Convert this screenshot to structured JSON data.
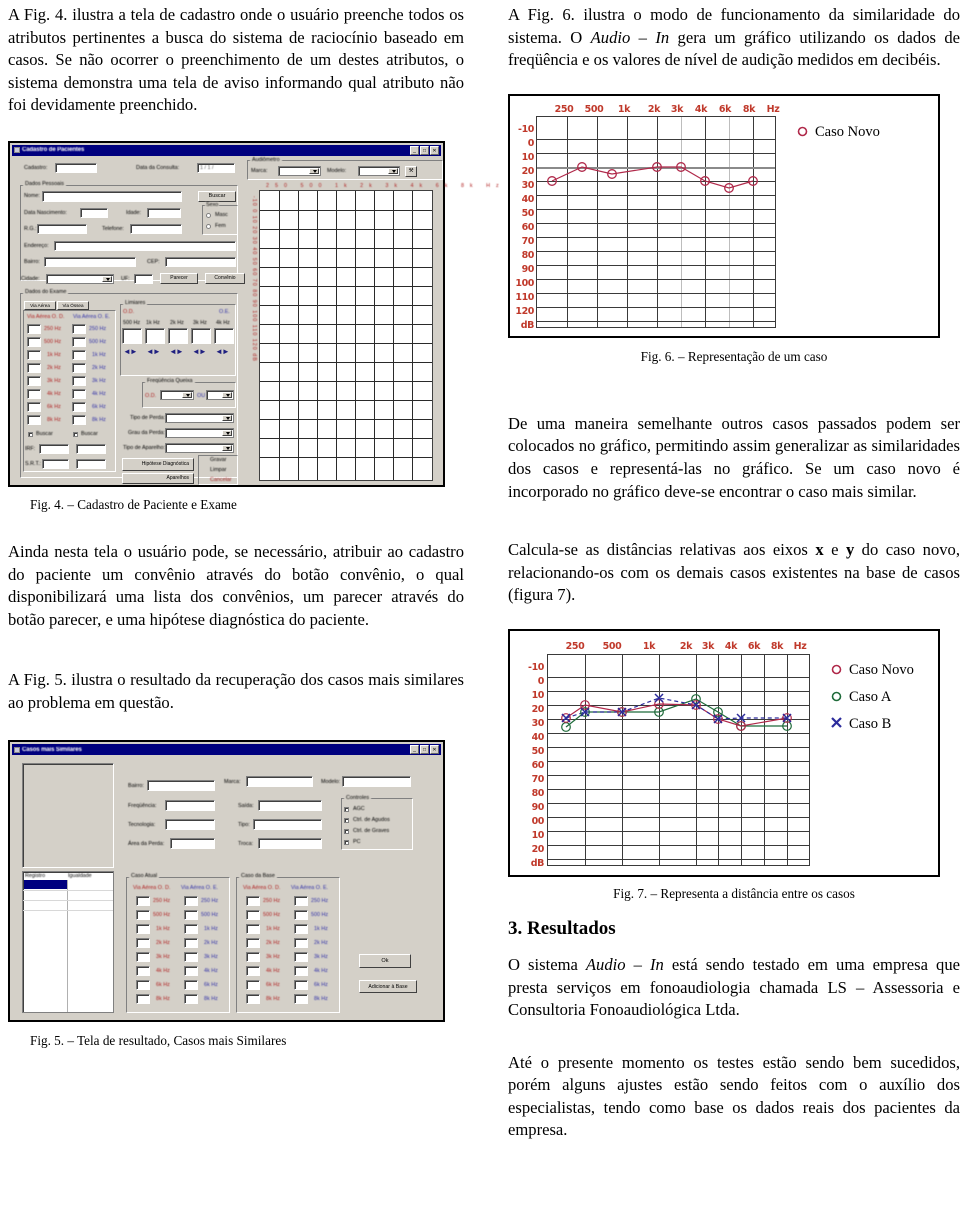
{
  "left_column": {
    "para1_prefix": "A Fig. 4.",
    "para1": "A Fig. 4. ilustra a tela de cadastro onde o usuário preenche todos os atributos pertinentes a busca do sistema de raciocínio baseado em casos. Se não ocorrer o preenchimento de um destes atributos, o sistema demonstra uma tela de aviso informando qual atributo não foi devidamente preenchido.",
    "fig4_caption": "Fig. 4. – Cadastro de Paciente e Exame",
    "para2": "Ainda nesta tela o usuário pode, se necessário, atribuir ao cadastro do paciente um convênio através do botão convênio, o qual disponibilizará uma lista dos convênios, um parecer através do botão parecer, e uma hipótese diagnóstica do paciente.",
    "para3": "A Fig. 5. ilustra o resultado da recuperação dos casos mais similares ao problema em questão.",
    "fig5_caption": "Fig. 5. – Tela de resultado, Casos mais Similares"
  },
  "right_column": {
    "para1_a": "A Fig. 6. ilustra o modo de funcionamento da similaridade do sistema. O ",
    "para1_italic": "Audio – In",
    "para1_b": " gera um gráfico utilizando os dados de freqüência e os valores de nível de audição medidos em decibéis.",
    "fig6_caption": "Fig. 6. – Representação de um caso",
    "para2": "De uma maneira semelhante outros casos passados podem ser colocados no gráfico, permitindo assim generalizar as similaridades dos casos e representá-las no gráfico. Se um caso novo é incorporado no gráfico deve-se encontrar o caso mais similar.",
    "para3_a": "Calcula-se as distâncias relativas aos eixos ",
    "para3_x": "x",
    "para3_mid": " e ",
    "para3_y": "y",
    "para3_b": " do caso novo, relacionando-os com os demais casos existentes na base de casos (figura 7).",
    "fig7_caption": "Fig. 7. – Representa a distância entre os casos",
    "section_heading": "3. Resultados",
    "para4_a": "O sistema ",
    "para4_italic": "Audio – In",
    "para4_b": " está sendo testado em uma empresa que presta serviços em fonoaudiologia chamada LS – Assessoria e Consultoria Fonoaudiológica Ltda.",
    "para5": "Até o presente momento os testes estão sendo bem sucedidos, porém alguns ajustes estão sendo feitos com o auxílio dos especialistas, tendo como base os dados reais dos pacientes da empresa."
  },
  "fig4_window": {
    "title": "Cadastro de Pacientes",
    "title_icon": "window-icon",
    "buttons": {
      "minimize": "_",
      "maximize": "□",
      "close": "✕"
    },
    "labels": {
      "cadastro": "Cadastro:",
      "data_consulta": "Data da Consulta:",
      "audiometro_group": "Audiômetro",
      "marca": "Marca:",
      "modelo": "Modelo:",
      "dados_pessoais": "Dados Pessoais",
      "nome": "Nome:",
      "buscar": "Buscar",
      "data_nascimento": "Data Nascimento:",
      "idade": "Idade:",
      "rg": "R.G.:",
      "telefone": "Telefone:",
      "endereco": "Endereço:",
      "bairro": "Bairro:",
      "cep": "CEP:",
      "cidade": "Cidade:",
      "uf": "UF:",
      "parecer": "Parecer",
      "convenio": "Convênio",
      "sexo_group": "Sexo",
      "sexo_masc": "Masc",
      "sexo_fem": "Fem",
      "dados_exame": "Dados do Exame",
      "tab_via_aerea": "Via Aérea",
      "tab_via_ossea": "Via Óssea",
      "via_aerea_od": "Via Aérea O. D.",
      "via_aerea_oe": "Via Aérea O. E.",
      "limiares": "Limiares",
      "od": "O.D.",
      "oe": "O.E.",
      "buscar_chk": "Buscar",
      "irf": "IRF:",
      "srt": "S.R.T.:",
      "freq_queixa": "Freqüência Queixa",
      "ou": "OU",
      "tipo_perda": "Tipo de Perda:",
      "grau_perda": "Grau da Perda:",
      "tipo_aparelho": "Tipo de Aparelho:",
      "hipotese": "Hipótese Diagnóstica",
      "aparelhos": "Aparelhos",
      "gravar": "Gravar",
      "limpar": "Limpar",
      "cancelar": "Cancelar"
    },
    "date_value": "1 / 1 /",
    "freq_cols": [
      "500 Hz",
      "1k Hz",
      "2k Hz",
      "3k Hz",
      "4k Hz"
    ],
    "freq_rows": [
      "250 Hz",
      "500 Hz",
      "1k Hz",
      "2k Hz",
      "3k Hz",
      "4k Hz",
      "6k Hz",
      "8k Hz"
    ],
    "mini_chart_x": [
      "250",
      "500",
      "1k",
      "2k",
      "3k",
      "4k",
      "6k",
      "8k",
      "Hz"
    ],
    "mini_chart_y": [
      "-10",
      "0",
      "10",
      "20",
      "30",
      "40",
      "50",
      "60",
      "70",
      "80",
      "90",
      "100",
      "110",
      "120",
      "dB"
    ]
  },
  "fig5_window": {
    "title": "Casos mais Similares",
    "buttons": {
      "minimize": "_",
      "maximize": "□",
      "close": "✕"
    },
    "labels": {
      "bairro": "Bairro:",
      "marca": "Marca:",
      "modelo": "Modelo:",
      "frequencia": "Freqüência:",
      "saida": "Saída:",
      "tecnologia": "Tecnologia:",
      "tipo": "Tipo:",
      "area_perda": "Área da Perda:",
      "troca": "Troca:",
      "controles_group": "Controles",
      "chk_agc": "AGC",
      "chk_agudos": "Ctrl. de Agudos",
      "chk_graves": "Ctrl. de Graves",
      "chk_pc": "PC",
      "col_registro": "Registro",
      "col_igualdade": "Igualdade",
      "caso_atual": "Caso Atual",
      "caso_da_base": "Caso da Base",
      "va_od": "Via Aérea O. D.",
      "va_oe": "Via Aérea O. E.",
      "ok": "Ok",
      "adicionar": "Adicionar à Base"
    },
    "freq_rows": [
      "250 Hz",
      "500 Hz",
      "1k Hz",
      "2k Hz",
      "3k Hz",
      "4k Hz",
      "6k Hz",
      "8k Hz"
    ]
  },
  "colors": {
    "axis_label_red": "#c0392b",
    "caso_novo": "#b0294a",
    "caso_a": "#1f6b3a",
    "caso_b": "#2c2c9c",
    "grid": "#3a3a3a",
    "title_bar": "#00007e"
  },
  "chart_data": [
    {
      "type": "line",
      "id": "fig6",
      "title": "Fig. 6. – Representação de um caso",
      "xlabel": "Hz",
      "ylabel": "dB",
      "x": [
        "250",
        "500",
        "1k",
        "2k",
        "3k",
        "4k",
        "6k",
        "8k"
      ],
      "x_axis_unit_label": "Hz",
      "y_ticks": [
        "-10",
        "0",
        "10",
        "20",
        "30",
        "40",
        "50",
        "60",
        "70",
        "80",
        "90",
        "100",
        "110",
        "120"
      ],
      "y_unit_label": "dB",
      "ylim": [
        -10,
        120
      ],
      "grid": true,
      "legend_position": "right",
      "series": [
        {
          "name": "Caso Novo",
          "marker": "circle",
          "color": "#b0294a",
          "values": [
            20,
            10,
            15,
            10,
            10,
            20,
            25,
            20
          ]
        }
      ]
    },
    {
      "type": "line",
      "id": "fig7",
      "title": "Fig. 7. – Representa a distância entre os casos",
      "xlabel": "Hz",
      "ylabel": "dB",
      "x": [
        "250",
        "500",
        "1k",
        "2k",
        "3k",
        "4k",
        "6k",
        "8k"
      ],
      "x_axis_unit_label": "Hz",
      "y_ticks": [
        "-10",
        "0",
        "10",
        "20",
        "30",
        "40",
        "50",
        "60",
        "70",
        "80",
        "90",
        "00",
        "10",
        "20"
      ],
      "y_unit_label": "dB",
      "ylim": [
        -10,
        120
      ],
      "grid": true,
      "legend_position": "right",
      "series": [
        {
          "name": "Caso Novo",
          "marker": "circle",
          "color": "#b0294a",
          "values": [
            19,
            10,
            15,
            9,
            10,
            20,
            25,
            19
          ]
        },
        {
          "name": "Caso A",
          "marker": "circle",
          "color": "#1f6b3a",
          "values": [
            26,
            15,
            15,
            15,
            6,
            15,
            25,
            25
          ]
        },
        {
          "name": "Caso B",
          "marker": "x",
          "color": "#2c2c9c",
          "dashed": true,
          "values": [
            19,
            15,
            15,
            5,
            10,
            20,
            19,
            19
          ]
        }
      ]
    }
  ]
}
